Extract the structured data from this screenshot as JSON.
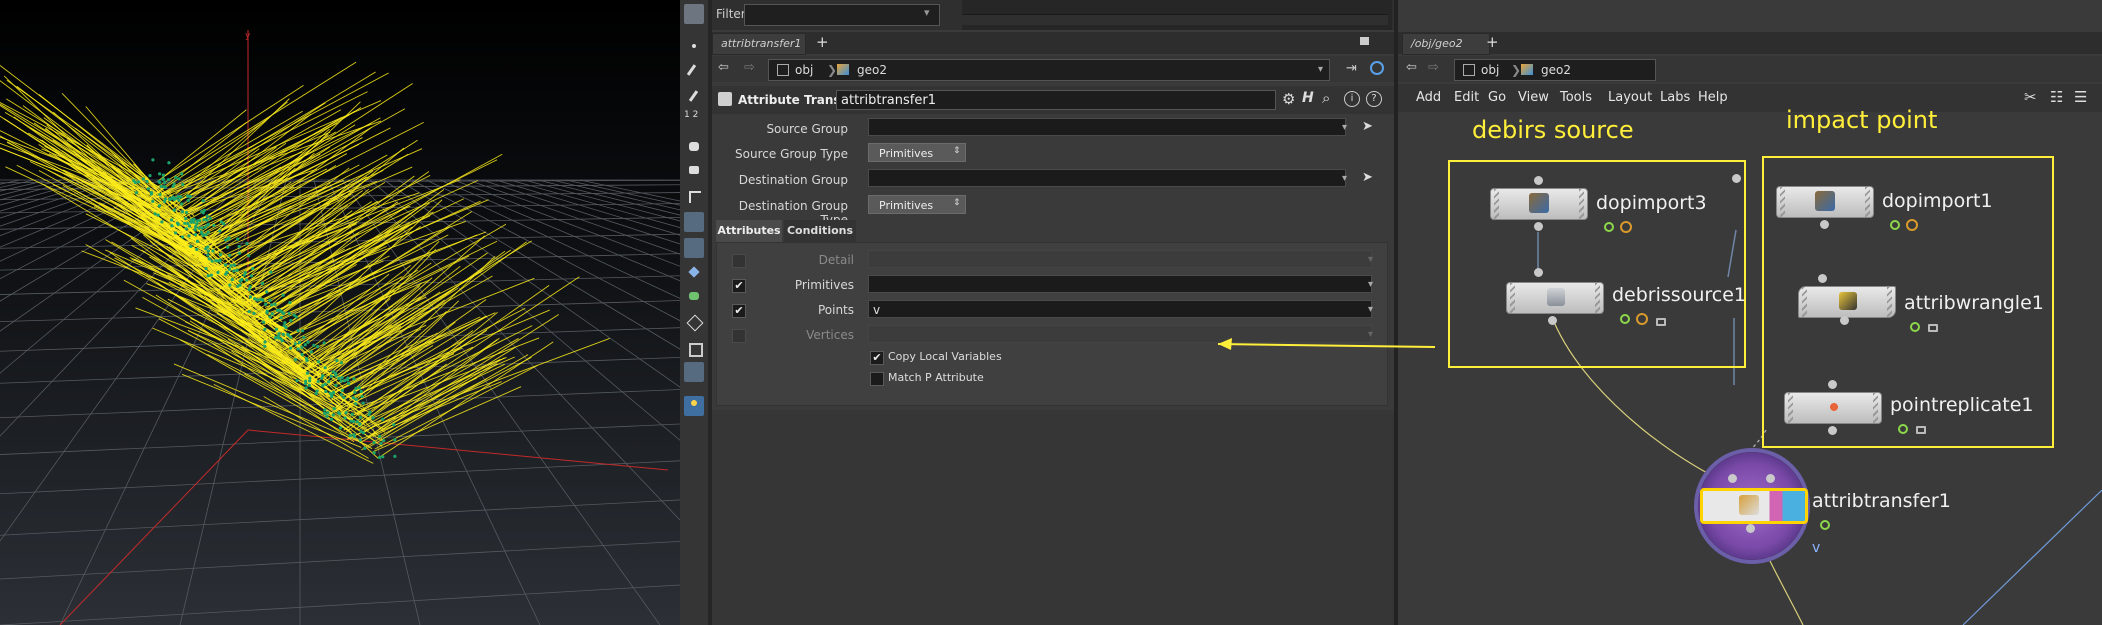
{
  "viewport": {
    "hair_color": "#ffef1a",
    "debris_color": "#1aa36b",
    "grid_color": "#555a60",
    "axis_x_color": "#c22a2a",
    "axis_y_color": "#c22a2a"
  },
  "filter": {
    "label": "Filter"
  },
  "param_pane": {
    "tab_label": "attribtransfer1",
    "close_glyph": "×",
    "add_glyph": "+",
    "path": {
      "root": "obj",
      "child": "geo2"
    },
    "node_type": "Attribute Transfer",
    "node_name": "attribtransfer1",
    "rows": [
      {
        "label": "Source Group",
        "value": "",
        "kind": "field"
      },
      {
        "label": "Source Group Type",
        "value": "Primitives",
        "kind": "menu"
      },
      {
        "label": "Destination Group",
        "value": "",
        "kind": "field"
      },
      {
        "label": "Destination Group Type",
        "value": "Primitives",
        "kind": "menu"
      }
    ],
    "tabs": [
      "Attributes",
      "Conditions"
    ],
    "attributes": [
      {
        "label": "Detail",
        "checked": false,
        "value": "",
        "enabled": false
      },
      {
        "label": "Primitives",
        "checked": true,
        "value": "",
        "enabled": true
      },
      {
        "label": "Points",
        "checked": true,
        "value": "v",
        "enabled": true
      },
      {
        "label": "Vertices",
        "checked": false,
        "value": "",
        "enabled": false
      }
    ],
    "copy_local_label": "Copy Local Variables",
    "copy_local_checked": true,
    "match_p_label": "Match P Attribute",
    "match_p_checked": false
  },
  "network_pane": {
    "tab_label": "/obj/geo2",
    "add_glyph": "+",
    "path": {
      "root": "obj",
      "child": "geo2"
    },
    "menu": [
      "Add",
      "Edit",
      "Go",
      "View",
      "Tools",
      "Layout",
      "Labs",
      "Help"
    ],
    "annotation_left": "debirs source",
    "annotation_right": "impact point",
    "nodes": {
      "dopimport3": "dopimport3",
      "debrissource1": "debrissource1",
      "dopimport1": "dopimport1",
      "attribwrangle1": "attribwrangle1",
      "pointreplicate1": "pointreplicate1",
      "attribtransfer1": "attribtransfer1"
    },
    "attribtransfer_v_label": "v",
    "annotation_color": "#ffef3a"
  }
}
